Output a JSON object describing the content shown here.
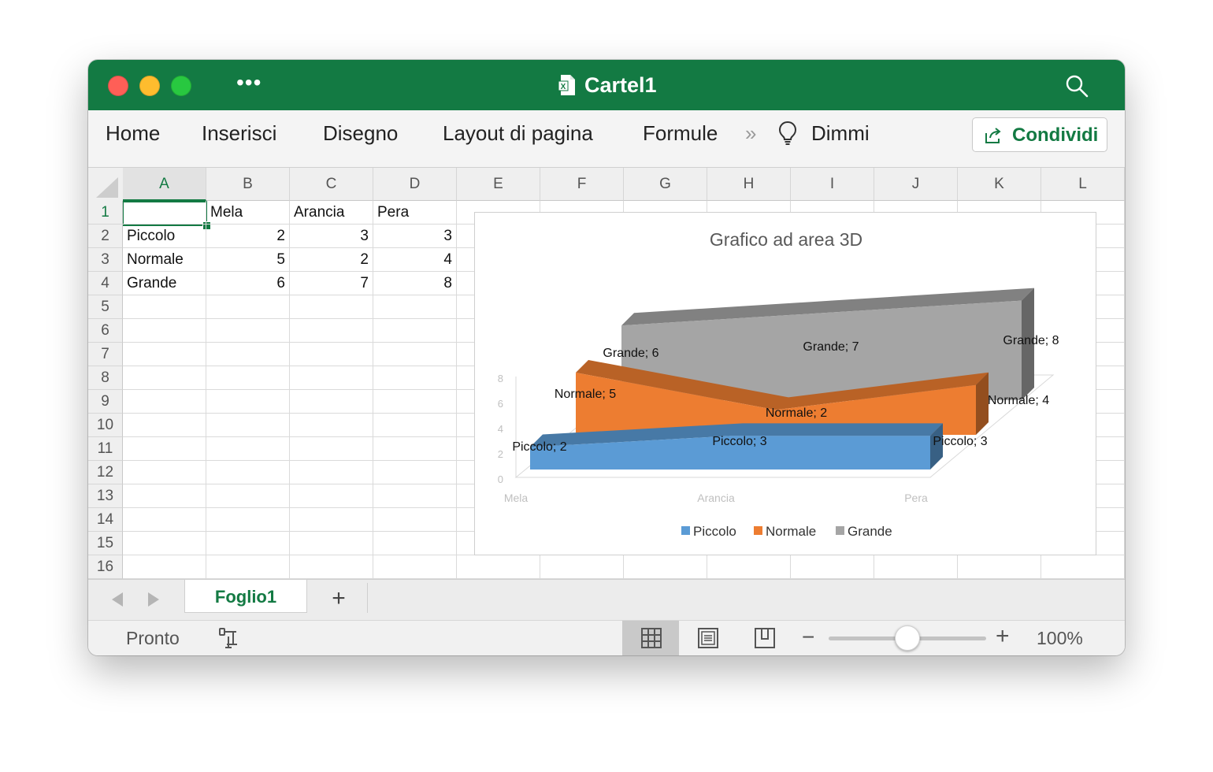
{
  "window": {
    "title": "Cartel1"
  },
  "ribbon": {
    "tabs": [
      "Home",
      "Inserisci",
      "Disegno",
      "Layout di pagina",
      "Formule"
    ],
    "tell_me": "Dimmi",
    "share_label": "Condividi"
  },
  "sheet": {
    "columns": [
      "A",
      "B",
      "C",
      "D",
      "E",
      "F",
      "G",
      "H",
      "I",
      "J",
      "K",
      "L"
    ],
    "rows": [
      "1",
      "2",
      "3",
      "4",
      "5",
      "6",
      "7",
      "8",
      "9",
      "10",
      "11",
      "12",
      "13",
      "14",
      "15",
      "16"
    ],
    "cells": {
      "A1": "",
      "B1": "Mela",
      "C1": "Arancia",
      "D1": "Pera",
      "A2": "Piccolo",
      "B2": "2",
      "C2": "3",
      "D2": "3",
      "A3": "Normale",
      "B3": "5",
      "C3": "2",
      "D3": "4",
      "A4": "Grande",
      "B4": "6",
      "C4": "7",
      "D4": "8"
    },
    "active_cell": "A1"
  },
  "chart_data": {
    "type": "area",
    "title": "Grafico ad area 3D",
    "categories": [
      "Mela",
      "Arancia",
      "Pera"
    ],
    "series": [
      {
        "name": "Piccolo",
        "values": [
          2,
          3,
          3
        ],
        "color": "#5b9bd5"
      },
      {
        "name": "Normale",
        "values": [
          5,
          2,
          4
        ],
        "color": "#ed7d31"
      },
      {
        "name": "Grande",
        "values": [
          6,
          7,
          8
        ],
        "color": "#a5a5a5"
      }
    ],
    "yticks": [
      "0",
      "2",
      "4",
      "6",
      "8"
    ],
    "ylim": [
      0,
      8
    ],
    "legend_position": "bottom",
    "data_labels": true
  },
  "sheet_tabs": {
    "active": "Foglio1",
    "add": "+"
  },
  "status": {
    "text": "Pronto",
    "zoom": "100%"
  }
}
